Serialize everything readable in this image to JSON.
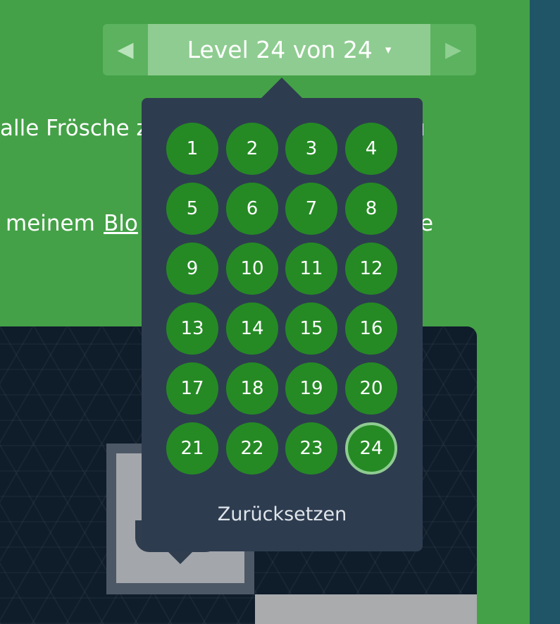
{
  "nav": {
    "prev_icon": "triangle-left-icon",
    "next_icon": "triangle-right-icon",
    "title": "Level 24 von 24",
    "caret": "▾"
  },
  "instructions": {
    "line1_start": "alle Frösche z",
    "line1_end": "u",
    "line2_start": "meinem ",
    "line2_link": "Blo",
    "line2_end": "e"
  },
  "levels": [
    "1",
    "2",
    "3",
    "4",
    "5",
    "6",
    "7",
    "8",
    "9",
    "10",
    "11",
    "12",
    "13",
    "14",
    "15",
    "16",
    "17",
    "18",
    "19",
    "20",
    "21",
    "22",
    "23",
    "24"
  ],
  "current_level": "24",
  "reset_label": "Zurücksetzen",
  "colors": {
    "background": "#44a147",
    "popup": "#2e3c50",
    "level_button": "#258a24",
    "current_ring": "#8fcc91"
  }
}
